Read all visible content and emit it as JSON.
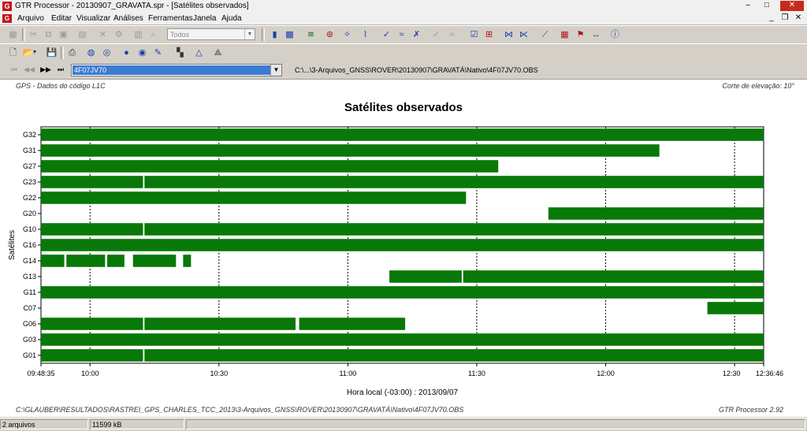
{
  "window": {
    "title": "GTR Processor - 20130907_GRAVATA.spr - [Satélites observados]",
    "app_icon": "G",
    "minimize": "–",
    "maximize": "□",
    "close": "✕",
    "mdi_minimize": "_",
    "mdi_restore": "❐",
    "mdi_close": "✕"
  },
  "menu": [
    "Arquivo",
    "Editar",
    "Visualizar",
    "Análises",
    "Ferramentas",
    "Janela",
    "Ajuda"
  ],
  "toolbar": {
    "combo_value": "Todos",
    "combo_arrow": "▼"
  },
  "navigation": {
    "first": "⏮",
    "prev": "◀◀",
    "next": "▶▶",
    "last": "⏭",
    "file_value": "4F07JV70",
    "file_arrow": "▼",
    "path": "C:\\...\\3-Arquivos_GNSS\\ROVER\\20130907\\GRAVATÁ\\Nativo\\4F07JV70.OBS"
  },
  "canvas": {
    "header_left": "GPS - Dados do código L1C",
    "header_right": "Corte de elevação: 10°",
    "footer_left": "C:\\GLAUBER\\RESULTADOS\\RASTREI_GPS_CHARLES_TCC_2013\\3-Arquivos_GNSS\\ROVER\\20130907\\GRAVATÁ\\Nativo\\4F07JV70.OBS",
    "footer_right": "GTR Processor 2.92"
  },
  "chart_data": {
    "type": "gantt",
    "title": "Satélites observados",
    "xlabel": "Hora local (-03:00) : 2013/09/07",
    "ylabel": "Satélites",
    "x_start": "09:48:35",
    "x_end": "12:36:46",
    "x_ticks": [
      "09:48:35",
      "10:00",
      "10:30",
      "11:00",
      "11:30",
      "12:00",
      "12:30",
      "12:36:46"
    ],
    "color": "#087808",
    "grid": "vertical dashed",
    "series": [
      {
        "name": "G32",
        "segments": [
          [
            "09:48:35",
            "12:36:46"
          ]
        ]
      },
      {
        "name": "G31",
        "segments": [
          [
            "09:48:35",
            "12:12:30"
          ]
        ]
      },
      {
        "name": "G27",
        "segments": [
          [
            "09:48:35",
            "11:35:00"
          ]
        ]
      },
      {
        "name": "G23",
        "segments": [
          [
            "09:48:35",
            "10:12:20"
          ],
          [
            "10:12:40",
            "12:36:46"
          ]
        ]
      },
      {
        "name": "G22",
        "segments": [
          [
            "09:48:35",
            "11:27:30"
          ]
        ]
      },
      {
        "name": "G20",
        "segments": [
          [
            "11:46:40",
            "12:36:46"
          ]
        ]
      },
      {
        "name": "G10",
        "segments": [
          [
            "09:48:35",
            "10:12:20"
          ],
          [
            "10:12:40",
            "12:36:46"
          ]
        ]
      },
      {
        "name": "G16",
        "segments": [
          [
            "09:48:35",
            "12:36:46"
          ]
        ]
      },
      {
        "name": "G14",
        "segments": [
          [
            "09:48:35",
            "09:54:00"
          ],
          [
            "09:54:30",
            "10:03:30"
          ],
          [
            "10:04:00",
            "10:08:00"
          ],
          [
            "10:10:00",
            "10:20:00"
          ],
          [
            "10:21:40",
            "10:23:30"
          ]
        ]
      },
      {
        "name": "G13",
        "segments": [
          [
            "11:09:40",
            "11:26:30"
          ],
          [
            "11:26:50",
            "12:36:46"
          ]
        ]
      },
      {
        "name": "G11",
        "segments": [
          [
            "09:48:35",
            "12:36:46"
          ]
        ]
      },
      {
        "name": "C07",
        "segments": [
          [
            "12:23:40",
            "12:36:46"
          ]
        ]
      },
      {
        "name": "G06",
        "segments": [
          [
            "09:48:35",
            "10:12:20"
          ],
          [
            "10:12:40",
            "10:47:50"
          ],
          [
            "10:48:40",
            "11:13:20"
          ]
        ]
      },
      {
        "name": "G03",
        "segments": [
          [
            "09:48:35",
            "12:36:46"
          ]
        ]
      },
      {
        "name": "G01",
        "segments": [
          [
            "09:48:35",
            "10:12:20"
          ],
          [
            "10:12:40",
            "12:36:46"
          ]
        ]
      }
    ]
  },
  "status": {
    "files": "2 arquivos",
    "size": "11599 kB"
  }
}
